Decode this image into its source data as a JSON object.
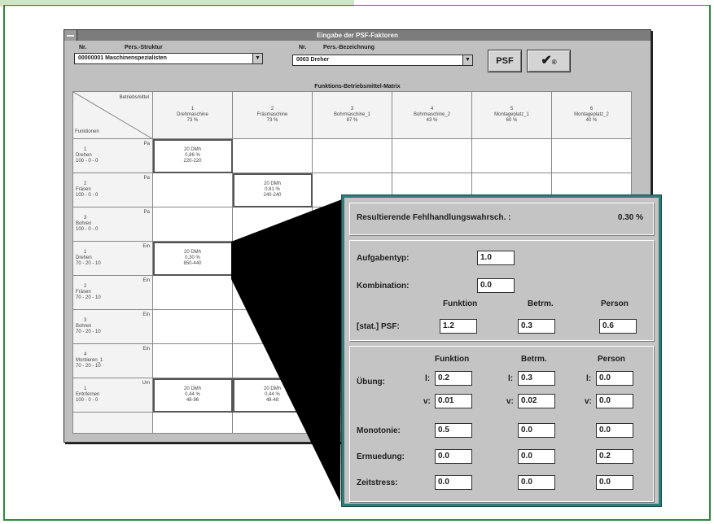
{
  "window": {
    "title": "Eingabe der PSF-Faktoren",
    "no_label": "Nr.",
    "pers_struktur_label": "Pers.-Struktur",
    "pers_struktur_value": "00000001   Maschinenspezialisten",
    "nr_label": "Nr.",
    "pers_bezeichnung_label": "Pers.-Bezeichnung",
    "pers_bezeichnung_value": "0003   Dreher",
    "psf_button": "PSF",
    "ok_button": "✔",
    "ok_suffix": "®"
  },
  "grid": {
    "title": "Funktions-Betriebsmittel-Matrix",
    "corner_top": "Betriebsmittel",
    "corner_bottom": "Funktionen",
    "columns": [
      {
        "num": "1",
        "name": "Drehmaschine",
        "pct": "73 %"
      },
      {
        "num": "2",
        "name": "Fräsmaschine",
        "pct": "73 %"
      },
      {
        "num": "3",
        "name": "Bohrmaschine_1",
        "pct": "87 %"
      },
      {
        "num": "4",
        "name": "Bohrmaschine_2",
        "pct": "43 %"
      },
      {
        "num": "5",
        "name": "Montageplatz_1",
        "pct": "60 %"
      },
      {
        "num": "6",
        "name": "Montageplatz_2",
        "pct": "40 %"
      }
    ],
    "rows": [
      {
        "num": "1",
        "code": "Pa",
        "name": "Drehen",
        "sub": "100 - 0 - 0",
        "cells": [
          [
            "20 DMh",
            "0,86 %",
            "220-220"
          ],
          [
            "",
            "",
            ""
          ],
          [
            "",
            "",
            ""
          ],
          [
            "",
            "",
            ""
          ],
          [
            "",
            "",
            ""
          ],
          [
            "",
            "",
            ""
          ]
        ]
      },
      {
        "num": "2",
        "code": "Pa",
        "name": "Fräsen",
        "sub": "100 - 0 - 0",
        "cells": [
          [
            "",
            "",
            ""
          ],
          [
            "20 DMh",
            "0,81 %",
            "240-240"
          ],
          [
            "",
            "",
            ""
          ],
          [
            "",
            "",
            ""
          ],
          [
            "",
            "",
            ""
          ],
          [
            "",
            "",
            ""
          ]
        ]
      },
      {
        "num": "3",
        "code": "Pa",
        "name": "Bohren",
        "sub": "100 - 0 - 0",
        "cells": [
          [
            "",
            "",
            ""
          ],
          [
            "",
            "",
            ""
          ],
          [
            "",
            "",
            ""
          ],
          [
            "",
            "",
            ""
          ],
          [
            "",
            "",
            ""
          ],
          [
            "",
            "",
            ""
          ]
        ]
      },
      {
        "num": "1",
        "code": "Ein",
        "name": "Drehen",
        "sub": "70 - 20 - 10",
        "cells": [
          [
            "20 DMh",
            "0,30 %",
            "850-440"
          ],
          [
            "",
            "",
            ""
          ],
          [
            "",
            "",
            ""
          ],
          [
            "",
            "",
            ""
          ],
          [
            "",
            "",
            ""
          ],
          [
            "",
            "",
            ""
          ]
        ]
      },
      {
        "num": "2",
        "code": "Ein",
        "name": "Fräsen",
        "sub": "70 - 20 - 10",
        "cells": [
          [
            "",
            "",
            ""
          ],
          [
            "",
            "",
            ""
          ],
          [
            "",
            "",
            ""
          ],
          [
            "",
            "",
            ""
          ],
          [
            "",
            "",
            ""
          ],
          [
            "",
            "",
            ""
          ]
        ]
      },
      {
        "num": "3",
        "code": "Ein",
        "name": "Bohren",
        "sub": "70 - 20 - 10",
        "cells": [
          [
            "",
            "",
            ""
          ],
          [
            "",
            "",
            ""
          ],
          [
            "",
            "",
            ""
          ],
          [
            "",
            "",
            ""
          ],
          [
            "",
            "",
            ""
          ],
          [
            "",
            "",
            ""
          ]
        ]
      },
      {
        "num": "4",
        "code": "Ein",
        "name": "Montieren_1",
        "sub": "70 - 20 - 10",
        "cells": [
          [
            "",
            "",
            ""
          ],
          [
            "",
            "",
            ""
          ],
          [
            "",
            "",
            ""
          ],
          [
            "",
            "",
            ""
          ],
          [
            "",
            "",
            ""
          ],
          [
            "",
            "",
            ""
          ]
        ]
      },
      {
        "num": "1",
        "code": "Um",
        "name": "Entnfernen",
        "sub": "100 - 0 - 0",
        "cells": [
          [
            "20 DMh",
            "0,44 %",
            "48-96"
          ],
          [
            "20 DMh",
            "0,44 %",
            "48-48"
          ],
          [
            "",
            "",
            ""
          ],
          [
            "",
            "",
            ""
          ],
          [
            "",
            "",
            ""
          ],
          [
            "",
            "",
            ""
          ]
        ]
      }
    ]
  },
  "detail": {
    "result_label": "Resultierende Fehlhandlungswahrsch. :",
    "result_value": "0.30 %",
    "aufgabentyp_label": "Aufgabentyp:",
    "aufgabentyp_value": "1.0",
    "kombination_label": "Kombination:",
    "kombination_value": "0.0",
    "col_funktion": "Funktion",
    "col_betrm": "Betrm.",
    "col_person": "Person",
    "stat_psf_label": "[stat.] PSF:",
    "stat_psf": [
      "1.2",
      "0.3",
      "0.6"
    ],
    "col_funktion_2": "Funktion",
    "col_betrm_2": "Betrm.",
    "col_person_2": "Person",
    "uebung_label": "Übung:",
    "l_prefix": "l:",
    "v_prefix": "v:",
    "uebung_l": [
      "0.2",
      "0.3",
      "0.0"
    ],
    "uebung_v": [
      "0.01",
      "0.02",
      "0.0"
    ],
    "monotonie_label": "Monotonie:",
    "monotonie": [
      "0.5",
      "0.0",
      "0.0"
    ],
    "ermuedung_label": "Ermuedung:",
    "ermuedung": [
      "0.0",
      "0.0",
      "0.2"
    ],
    "zeitstress_label": "Zeitstress:",
    "zeitstress": [
      "0.0",
      "0.0",
      "0.0"
    ]
  },
  "colors": {
    "frame_green": "#2d8a3b",
    "detail_border": "#2a7e7a",
    "window_gray": "#c0c0c0"
  }
}
